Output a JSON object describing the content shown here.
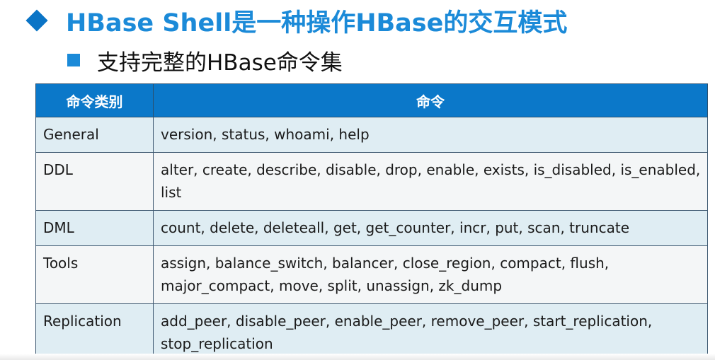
{
  "title": "HBase Shell是一种操作HBase的交互模式",
  "subtitle": "支持完整的HBase命令集",
  "table": {
    "headers": [
      "命令类别",
      "命令"
    ],
    "rows": [
      {
        "category": "General",
        "commands": "version, status, whoami, help"
      },
      {
        "category": "DDL",
        "commands": "alter, create, describe, disable, drop, enable, exists, is_disabled, is_enabled, list"
      },
      {
        "category": "DML",
        "commands": "count, delete, deleteall, get, get_counter, incr, put, scan, truncate"
      },
      {
        "category": "Tools",
        "commands": "assign, balance_switch, balancer, close_region, compact, flush, major_compact, move, split, unassign, zk_dump"
      },
      {
        "category": "Replication",
        "commands": "add_peer, disable_peer, enable_peer, remove_peer, start_replication, stop_replication"
      }
    ]
  },
  "icons": {
    "title_bullet": "diamond-icon",
    "subtitle_bullet": "square-bullet-icon"
  },
  "colors": {
    "accent": "#1b8ad8",
    "header_bg": "#0b78c9",
    "row_odd": "#dfedf3",
    "row_even": "#f4f6f7"
  }
}
